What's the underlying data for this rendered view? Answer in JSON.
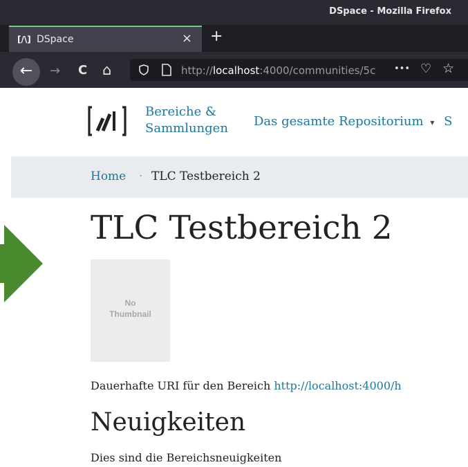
{
  "window": {
    "title": "DSpace - Mozilla Firefox"
  },
  "tab": {
    "title": "DSpace",
    "favicon_text": "[/\\]",
    "close_glyph": "×"
  },
  "toolbar": {
    "new_tab_glyph": "+",
    "back_glyph": "←",
    "forward_glyph": "→",
    "reload_glyph": "C",
    "home_glyph": "⌂",
    "url_prefix": "http://",
    "url_host": "localhost",
    "url_rest": ":4000/communities/5c",
    "more_glyph": "•••",
    "pocket_glyph": "♡",
    "bookmark_glyph": "☆"
  },
  "header": {
    "logo_text": "[/\\]",
    "nav": {
      "communities_line1": "Bereiche &",
      "communities_line2": "Sammlungen",
      "all_repo": "Das gesamte Repositorium",
      "all_repo_caret": "▾",
      "cut_text": "S"
    }
  },
  "breadcrumb": {
    "home": "Home",
    "separator": "·",
    "current": "TLC Testbereich 2"
  },
  "page": {
    "title": "TLC Testbereich 2",
    "thumbnail_line1": "No",
    "thumbnail_line2": "Thumbnail",
    "uri_label": "Dauerhafte URI für den Bereich",
    "uri_value": "http://localhost:4000/h",
    "news_heading": "Neuigkeiten",
    "news_text": "Dies sind die Bereichsneuigkeiten"
  },
  "colors": {
    "link": "#207698",
    "arrow": "#4a8a2e",
    "chrome_dark": "#2b2a33",
    "breadcrumb_bg": "#e9ecef"
  },
  "icons": {
    "arrow": "right-arrow-icon",
    "back": "back-arrow-icon",
    "forward": "forward-arrow-icon",
    "reload": "reload-icon",
    "home": "home-icon",
    "shield": "tracking-shield-icon",
    "page": "page-info-icon",
    "more": "more-actions-icon",
    "pocket": "pocket-icon",
    "bookmark": "bookmark-star-icon"
  }
}
